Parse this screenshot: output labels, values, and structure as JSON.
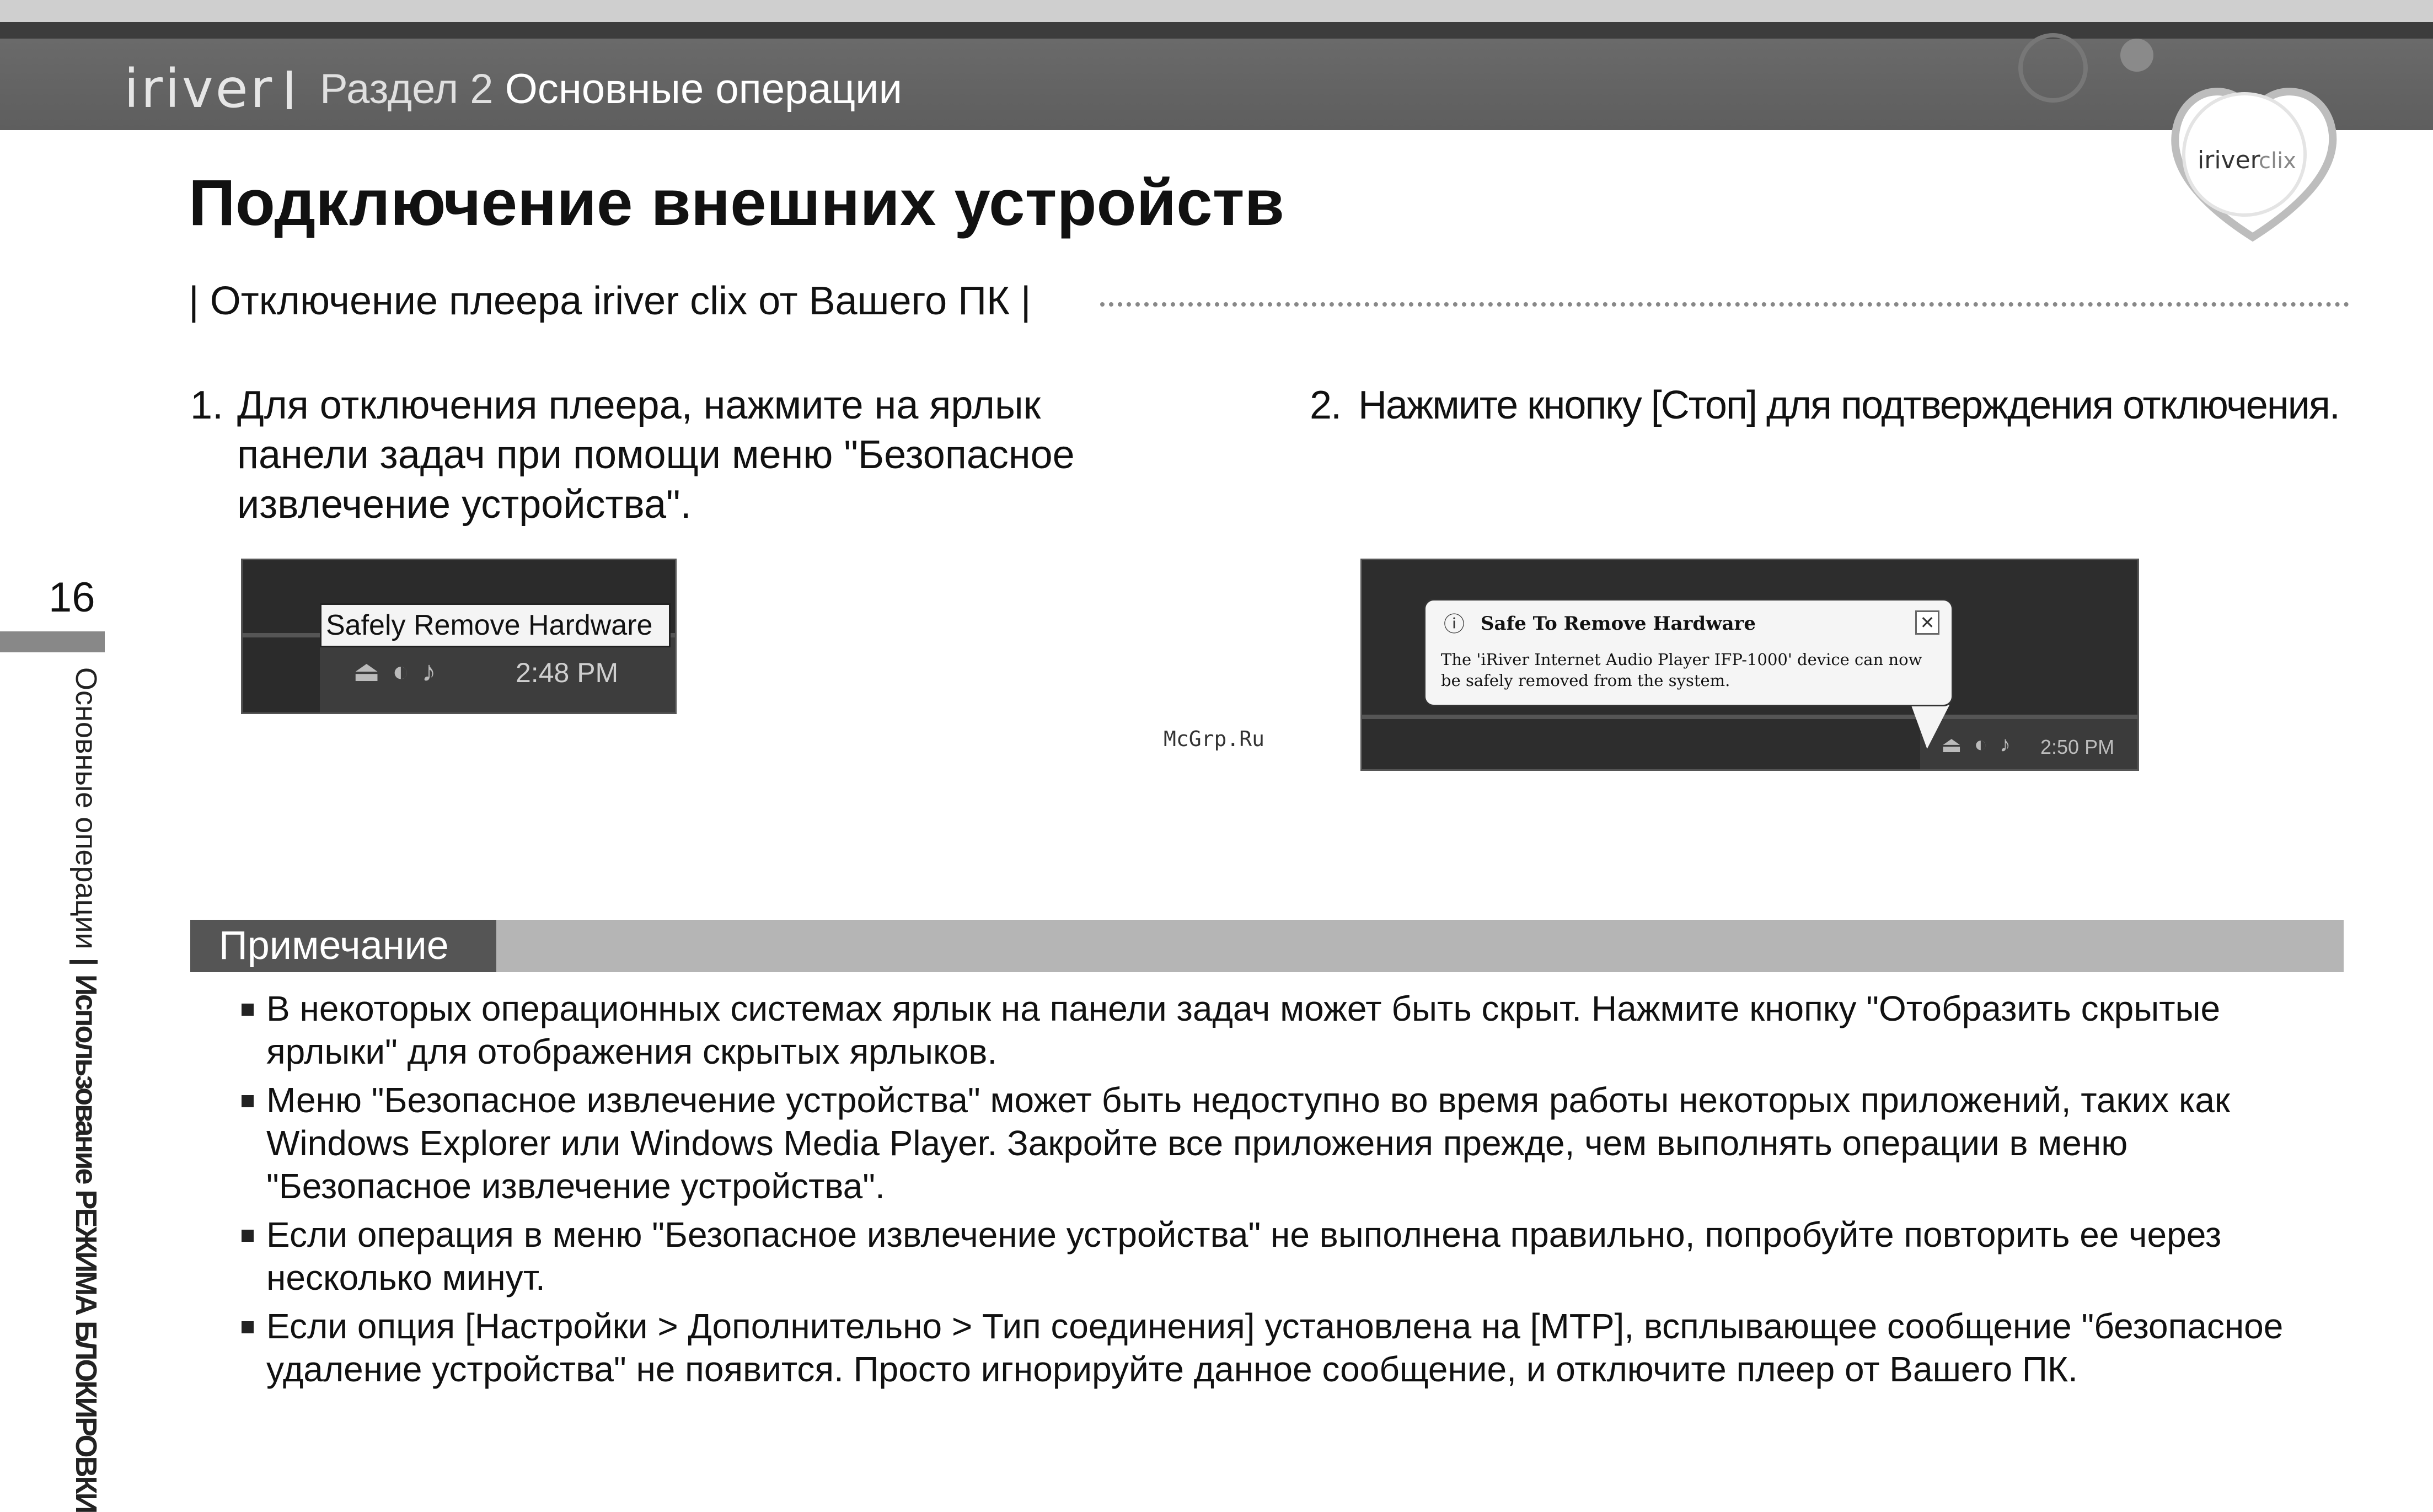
{
  "header": {
    "brand": "iriver",
    "section_prefix": "Раздел 2",
    "section_title": "Основные операции",
    "badge_brand": "iriver",
    "badge_model": "clix"
  },
  "page": {
    "title": "Подключение внешних устройств",
    "subtitle": "| Отключение плеера iriver clix от Вашего ПК |",
    "number": "16"
  },
  "side": {
    "chapter": "Основные операции",
    "separator": "|",
    "topic": "Использование РЕЖИМА БЛОКИРОВКИ"
  },
  "steps": [
    {
      "number": "1.",
      "lines": [
        "Для отключения плеера, нажмите на ярлык",
        "панели задач при помощи меню \"Безопасное",
        "извлечение устройства\"."
      ]
    },
    {
      "number": "2.",
      "lines": [
        "Нажмите кнопку [Стоп] для подтверждения отключения."
      ]
    }
  ],
  "screenshot1": {
    "tooltip": "Safely Remove Hardware",
    "time": "2:48 PM"
  },
  "screenshot2": {
    "balloon_title": "Safe To Remove Hardware",
    "balloon_text": "The 'iRiver Internet Audio Player IFP-1000' device can now be safely removed from the system.",
    "close_glyph": "✕",
    "info_glyph": "ⓘ",
    "time": "2:50 PM"
  },
  "watermark": "McGrp.Ru",
  "note": {
    "label": "Примечание",
    "items": [
      "В некоторых операционных системах ярлык на панели задач может быть скрыт. Нажмите кнопку \"Отобразить скрытые ярлыки\" для отображения скрытых ярлыков.",
      "Меню \"Безопасное извлечение устройства\" может быть недоступно во время работы некоторых приложений, таких как Windows Explorer или Windows Media Player. Закройте все приложения прежде, чем выполнять операции в меню \"Безопасное извлечение устройства\".",
      "Если операция в меню \"Безопасное извлечение устройства\" не выполнена правильно, попробуйте повторить ее через несколько минут.",
      "Если опция [Настройки > Дополнительно > Тип соединения] установлена на [MTP], всплывающее сообщение \"безопасное удаление устройства\" не появится. Просто игнорируйте данное сообщение, и отключите плеер от Вашего ПК."
    ]
  },
  "colors": {
    "header_bg": "#5e5e5e",
    "note_label_bg": "#555555",
    "note_bar_bg": "#b5b5b5",
    "side_mark": "#888888"
  }
}
